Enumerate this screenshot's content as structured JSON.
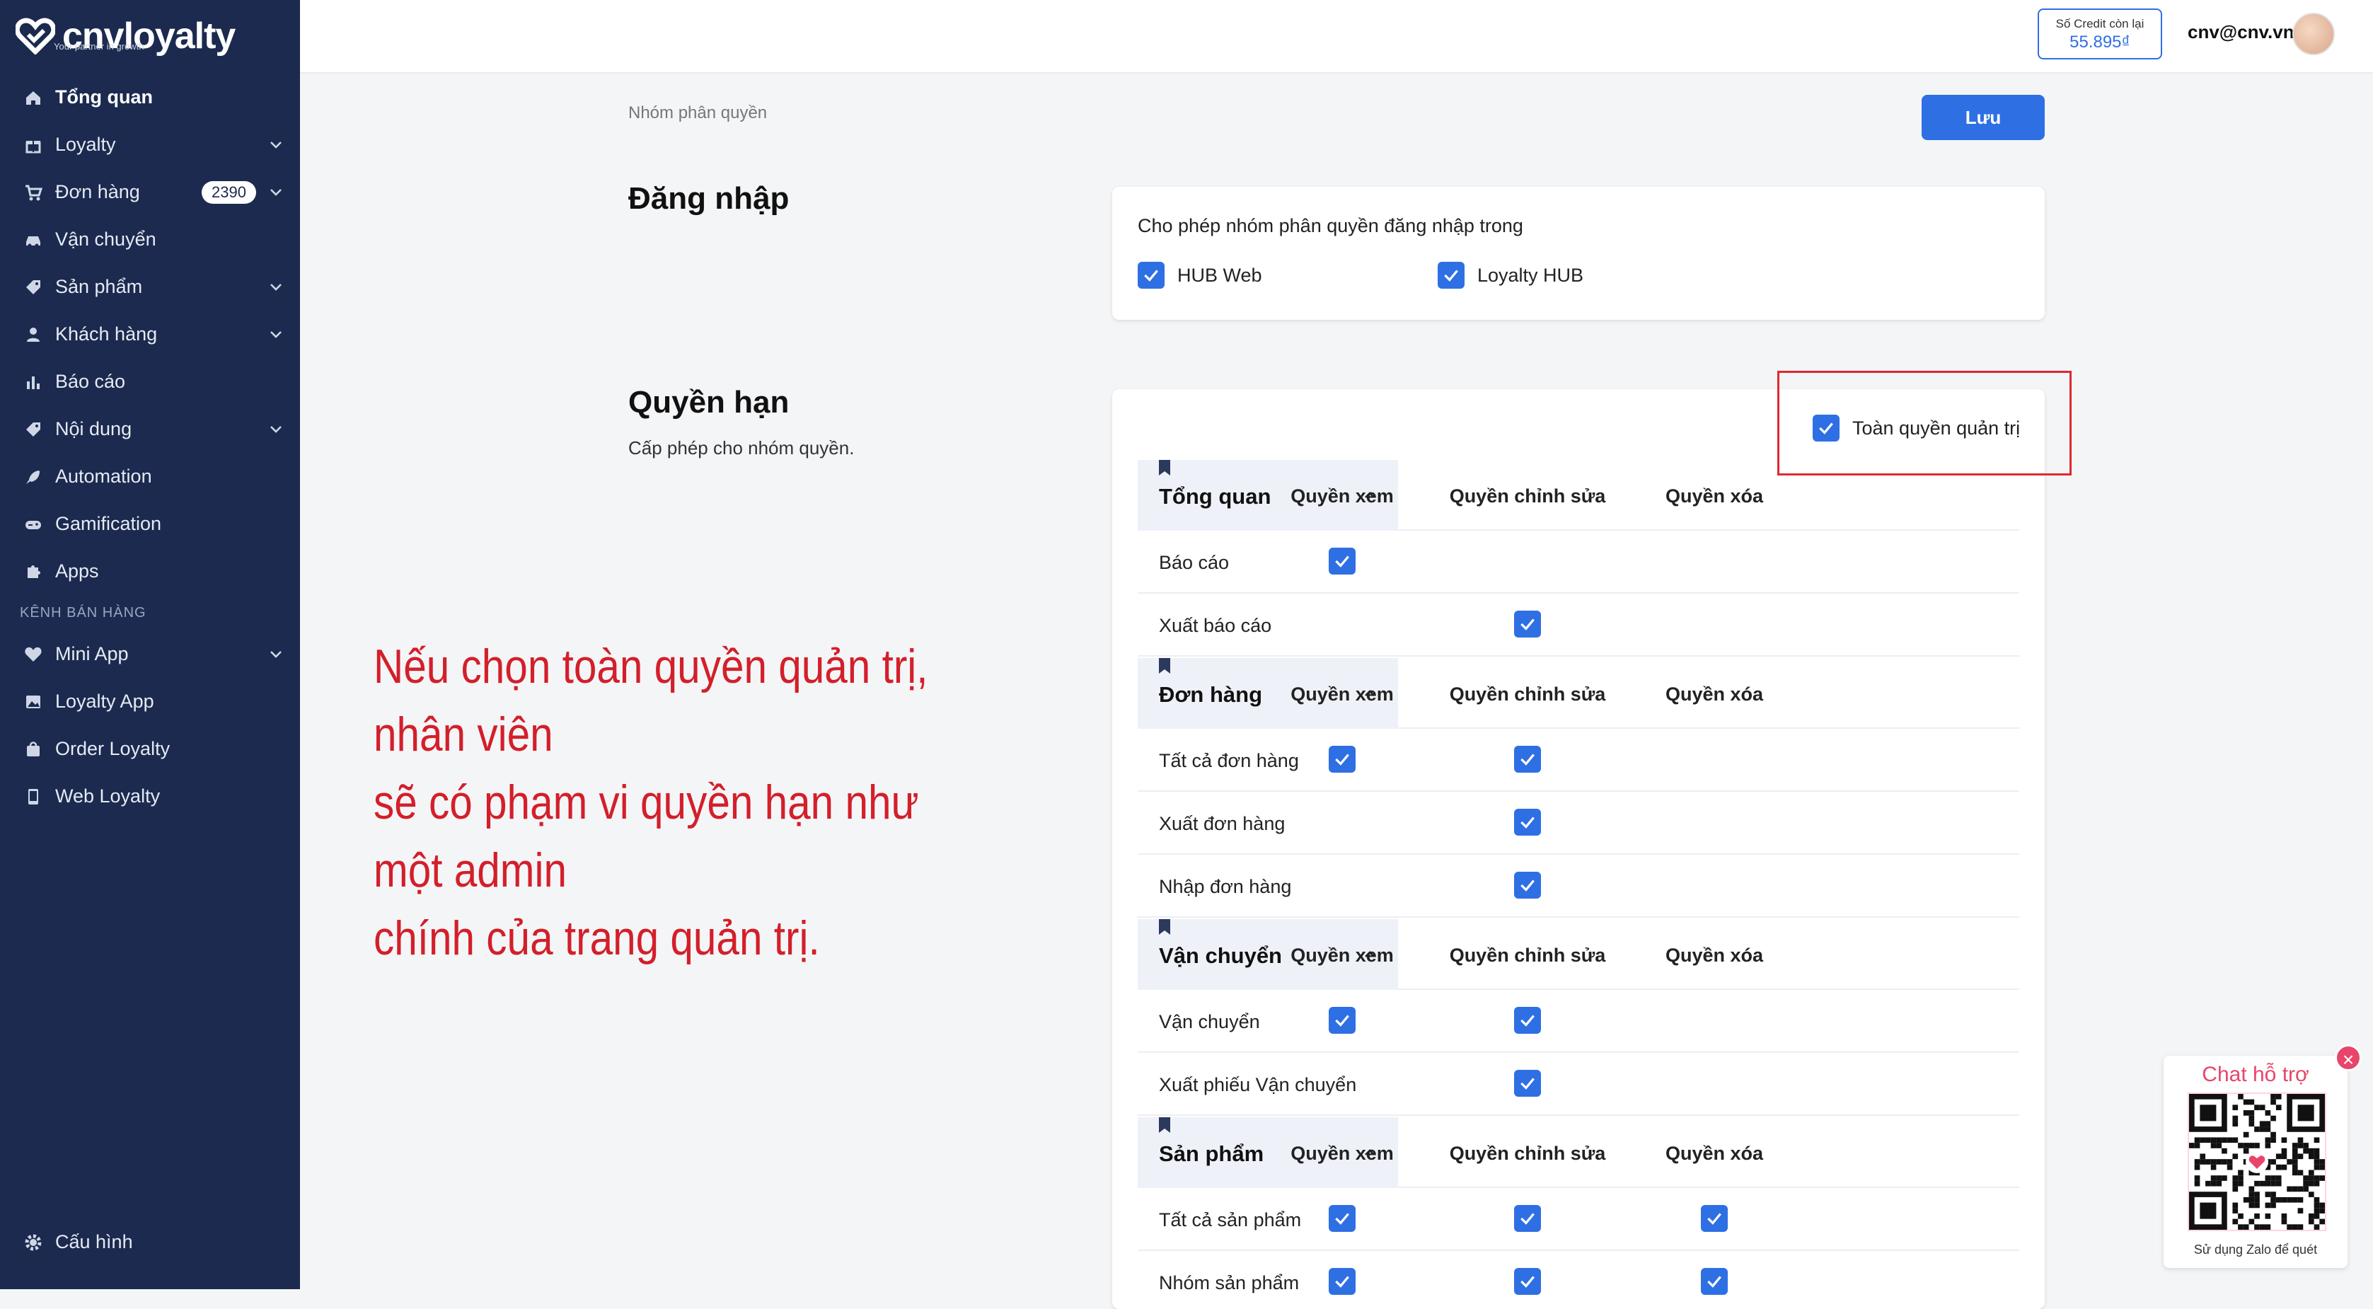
{
  "brand": {
    "name": "cnvloyalty",
    "tagline": "Your partner in growth"
  },
  "sidebar": {
    "items": [
      {
        "label": "Tổng quan",
        "icon": "home-icon",
        "active": true
      },
      {
        "label": "Loyalty",
        "icon": "gift-icon",
        "expandable": true
      },
      {
        "label": "Đơn hàng",
        "icon": "cart-icon",
        "expandable": true,
        "badge": "2390"
      },
      {
        "label": "Vận chuyển",
        "icon": "car-icon"
      },
      {
        "label": "Sản phẩm",
        "icon": "tag-icon",
        "expandable": true
      },
      {
        "label": "Khách hàng",
        "icon": "user-icon",
        "expandable": true
      },
      {
        "label": "Báo cáo",
        "icon": "chart-icon"
      },
      {
        "label": "Nội dung",
        "icon": "tag-icon",
        "expandable": true
      },
      {
        "label": "Automation",
        "icon": "rocket-icon"
      },
      {
        "label": "Gamification",
        "icon": "gamepad-icon"
      },
      {
        "label": "Apps",
        "icon": "puzzle-icon"
      }
    ],
    "section_label": "KÊNH BÁN HÀNG",
    "channel_items": [
      {
        "label": "Mini App",
        "icon": "heart-icon",
        "expandable": true
      },
      {
        "label": "Loyalty App",
        "icon": "image-icon"
      },
      {
        "label": "Order Loyalty",
        "icon": "bag-icon"
      },
      {
        "label": "Web Loyalty",
        "icon": "phone-icon"
      }
    ],
    "settings_label": "Cấu hình"
  },
  "header": {
    "credit_label": "Số Credit còn lại",
    "credit_value": "55.895₫",
    "user_email": "cnv@cnv.vn"
  },
  "page": {
    "breadcrumb": "Nhóm phân quyền",
    "save_label": "Lưu"
  },
  "login_section": {
    "title": "Đăng nhập",
    "description": "Cho phép nhóm phân quyền đăng nhập trong",
    "options": [
      {
        "label": "HUB Web",
        "checked": true
      },
      {
        "label": "Loyalty HUB",
        "checked": true
      }
    ]
  },
  "permission_section": {
    "title": "Quyền hạn",
    "subtitle": "Cấp phép cho nhóm quyền.",
    "full_admin_label": "Toàn quyền quản trị",
    "full_admin_checked": true,
    "columns": [
      "Quyền xem",
      "Quyền chỉnh sửa",
      "Quyền xóa"
    ],
    "groups": [
      {
        "name": "Tổng quan",
        "rows": [
          {
            "label": "Báo cáo",
            "checks": [
              true,
              false,
              false
            ]
          },
          {
            "label": "Xuất báo cáo",
            "checks": [
              false,
              true,
              false
            ]
          }
        ]
      },
      {
        "name": "Đơn hàng",
        "rows": [
          {
            "label": "Tất cả đơn hàng",
            "checks": [
              true,
              true,
              false
            ]
          },
          {
            "label": "Xuất đơn hàng",
            "checks": [
              false,
              true,
              false
            ]
          },
          {
            "label": "Nhập đơn hàng",
            "checks": [
              false,
              true,
              false
            ]
          }
        ]
      },
      {
        "name": "Vận chuyển",
        "rows": [
          {
            "label": "Vận chuyển",
            "checks": [
              true,
              true,
              false
            ]
          },
          {
            "label": "Xuất phiếu Vận chuyển",
            "checks": [
              false,
              true,
              false
            ]
          }
        ]
      },
      {
        "name": "Sản phẩm",
        "rows": [
          {
            "label": "Tất cả sản phẩm",
            "checks": [
              true,
              true,
              true
            ]
          },
          {
            "label": "Nhóm sản phẩm",
            "checks": [
              true,
              true,
              true
            ]
          }
        ]
      }
    ]
  },
  "annotation": {
    "lines": [
      "Nếu chọn toàn quyền quản trị, nhân viên",
      "sẽ có phạm vi quyền hạn như một admin",
      "chính của trang quản trị."
    ]
  },
  "chat_widget": {
    "title": "Chat hỗ trợ",
    "note": "Sử dụng Zalo để quét",
    "close_label": "×"
  },
  "colors": {
    "sidebar_bg": "#1b2a4e",
    "accent": "#2f6fe4",
    "annotation": "#d31f2a",
    "chat_pink": "#e8456a"
  }
}
